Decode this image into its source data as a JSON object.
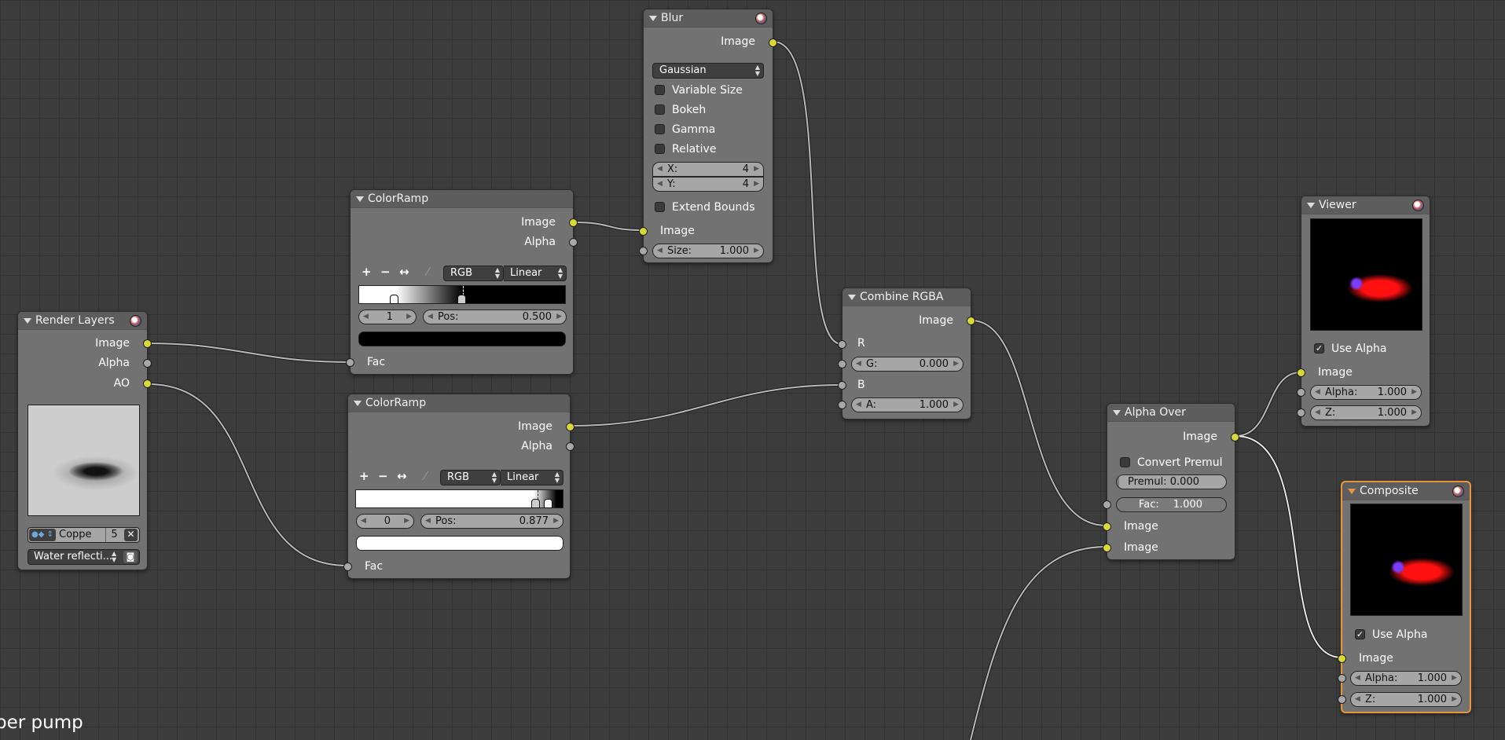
{
  "nodes": {
    "render_layers": {
      "title": "Render Layers",
      "outputs": [
        "Image",
        "Alpha",
        "AO"
      ],
      "scene_name": "Coppe",
      "users": "5",
      "layer": "Water reflecti..."
    },
    "colorramp1": {
      "title": "ColorRamp",
      "outputs": [
        "Image",
        "Alpha"
      ],
      "mode": "RGB",
      "interp": "Linear",
      "index": "1",
      "pos_label": "Pos:",
      "pos": "0.500",
      "input": "Fac",
      "active_color": "#000000"
    },
    "colorramp2": {
      "title": "ColorRamp",
      "outputs": [
        "Image",
        "Alpha"
      ],
      "mode": "RGB",
      "interp": "Linear",
      "index": "0",
      "pos_label": "Pos:",
      "pos": "0.877",
      "input": "Fac",
      "active_color": "#ffffff"
    },
    "blur": {
      "title": "Blur",
      "output": "Image",
      "filter": "Gaussian",
      "checkboxes": [
        "Variable Size",
        "Bokeh",
        "Gamma",
        "Relative"
      ],
      "x_label": "X:",
      "x": "4",
      "y_label": "Y:",
      "y": "4",
      "extend": "Extend Bounds",
      "input": "Image",
      "size_label": "Size:",
      "size": "1.000"
    },
    "combine": {
      "title": "Combine RGBA",
      "output": "Image",
      "r": "R",
      "g_label": "G:",
      "g": "0.000",
      "b": "B",
      "a_label": "A:",
      "a": "1.000"
    },
    "alpha_over": {
      "title": "Alpha Over",
      "output": "Image",
      "convert": "Convert Premul",
      "premul_label": "Premul:",
      "premul": "0.000",
      "fac_label": "Fac:",
      "fac": "1.000",
      "input1": "Image",
      "input2": "Image"
    },
    "viewer": {
      "title": "Viewer",
      "use_alpha": "Use Alpha",
      "input": "Image",
      "alpha_label": "Alpha:",
      "alpha": "1.000",
      "z_label": "Z:",
      "z": "1.000"
    },
    "composite": {
      "title": "Composite",
      "use_alpha": "Use Alpha",
      "input": "Image",
      "alpha_label": "Alpha:",
      "alpha": "1.000",
      "z_label": "Z:",
      "z": "1.000"
    }
  },
  "overlay_text": "per pump",
  "colors": {
    "socket_color": "#d8d838",
    "socket_value": "#a8a8a8",
    "active_border": "#e8963a",
    "node_body": "#727272",
    "node_header": "#5d5d5d"
  }
}
